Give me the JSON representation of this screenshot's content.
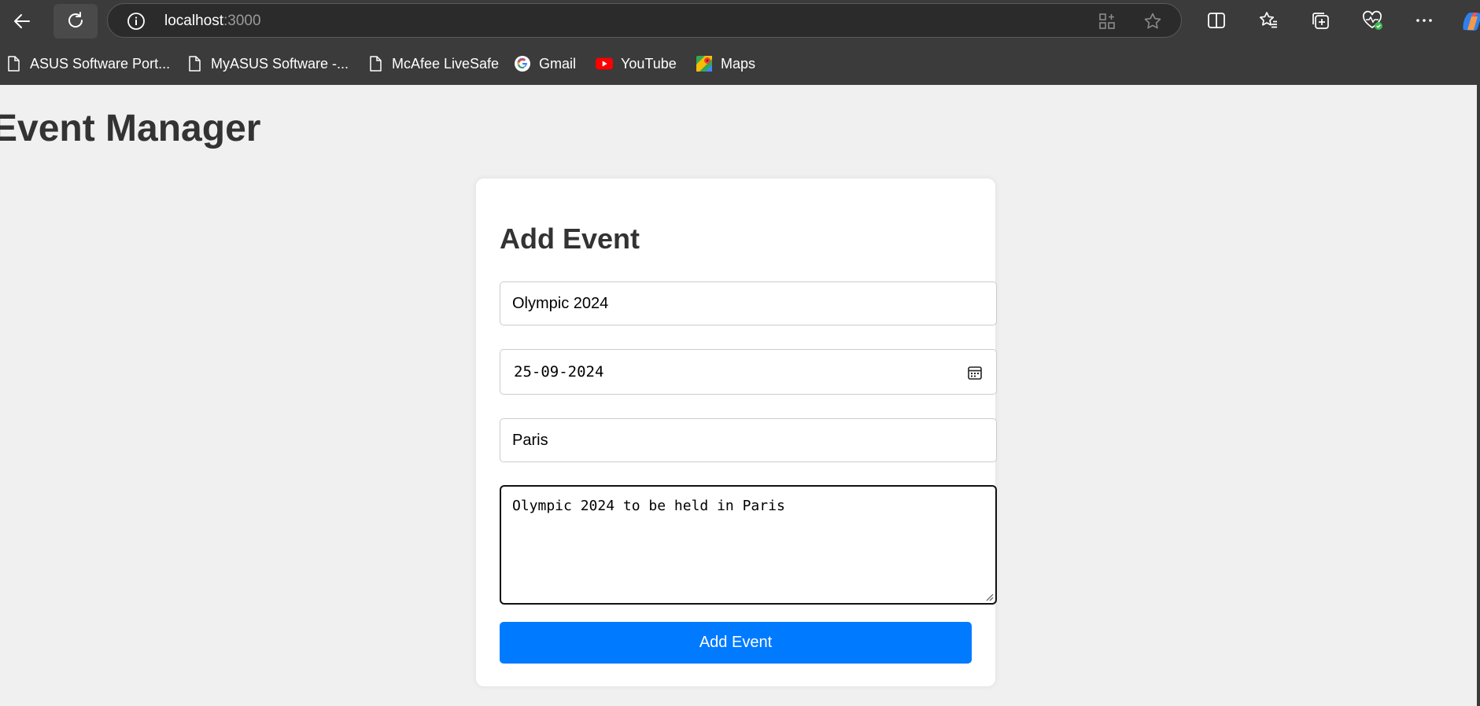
{
  "browser": {
    "url_host": "localhost",
    "url_port": ":3000",
    "bookmarks": [
      {
        "label": "ASUS Software Port...",
        "icon": "page-icon"
      },
      {
        "label": "MyASUS Software -...",
        "icon": "page-icon"
      },
      {
        "label": "McAfee LiveSafe",
        "icon": "page-icon"
      },
      {
        "label": "Gmail",
        "icon": "google-icon"
      },
      {
        "label": "YouTube",
        "icon": "youtube-icon"
      },
      {
        "label": "Maps",
        "icon": "maps-icon"
      }
    ]
  },
  "page": {
    "title": "Event Manager"
  },
  "form": {
    "title": "Add Event",
    "name_value": "Olympic 2024",
    "date_value": "25-09-2024",
    "location_value": "Paris",
    "description_value": "Olympic 2024 to be held in Paris",
    "submit_label": "Add Event"
  },
  "colors": {
    "accent": "#007bff",
    "page_bg": "#f0f0f0",
    "chrome_bg": "#3b3b3b"
  }
}
